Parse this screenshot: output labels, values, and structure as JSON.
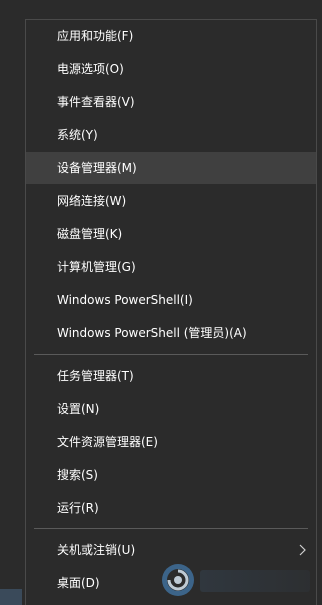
{
  "menu": {
    "items": [
      {
        "label": "应用和功能(F)"
      },
      {
        "label": "电源选项(O)"
      },
      {
        "label": "事件查看器(V)"
      },
      {
        "label": "系统(Y)"
      },
      {
        "label": "设备管理器(M)",
        "highlighted": true
      },
      {
        "label": "网络连接(W)"
      },
      {
        "label": "磁盘管理(K)"
      },
      {
        "label": "计算机管理(G)"
      },
      {
        "label": "Windows PowerShell(I)"
      },
      {
        "label": "Windows PowerShell (管理员)(A)"
      },
      {
        "label": "任务管理器(T)"
      },
      {
        "label": "设置(N)"
      },
      {
        "label": "文件资源管理器(E)"
      },
      {
        "label": "搜索(S)"
      },
      {
        "label": "运行(R)"
      },
      {
        "label": "关机或注销(U)",
        "has_submenu": true
      },
      {
        "label": "桌面(D)"
      }
    ],
    "submenu_icon": "chevron-right-icon"
  },
  "colors": {
    "background": "#2b2b2b",
    "highlight": "#404040",
    "text": "#ffffff",
    "separator": "#5a5a5a"
  },
  "watermark": {
    "icon": "swirl-logo-icon"
  }
}
